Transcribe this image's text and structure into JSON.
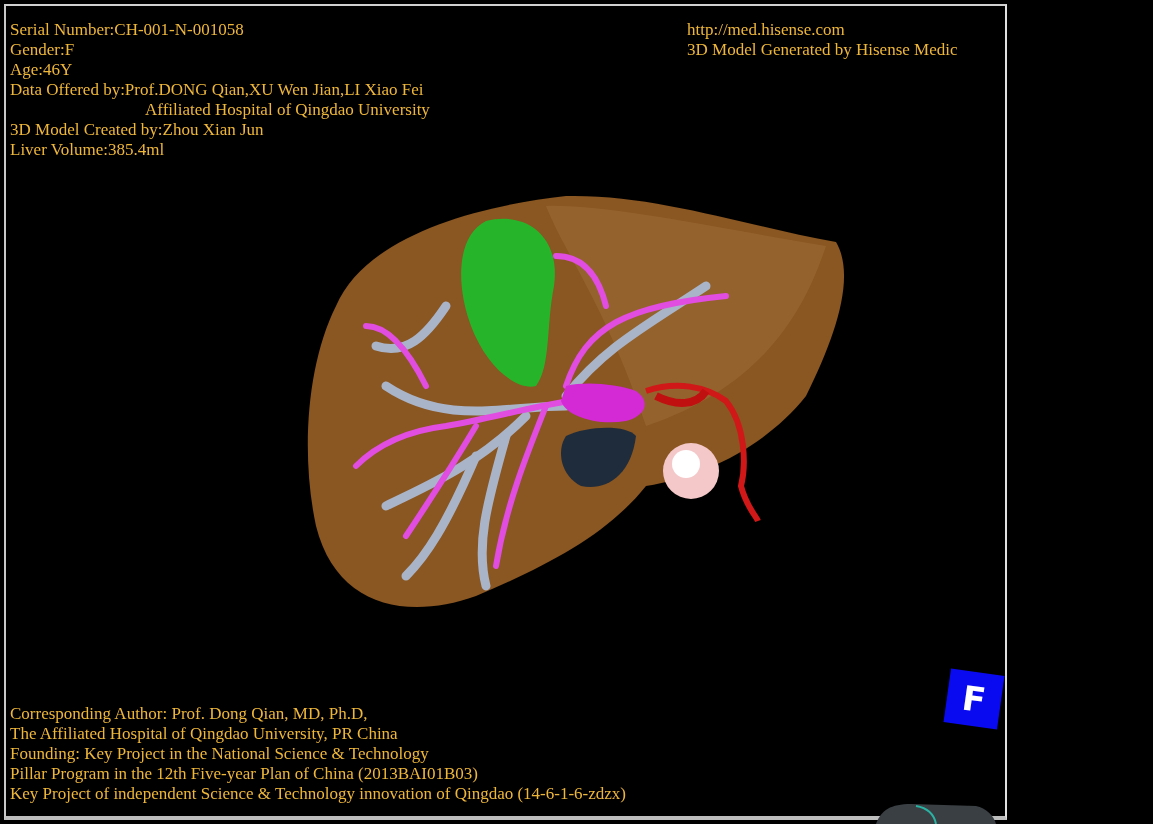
{
  "viewport": {
    "patient_info": [
      {
        "kind": "line",
        "text": "Serial Number:CH-001-N-001058"
      },
      {
        "kind": "line",
        "text": "Gender:F"
      },
      {
        "kind": "line",
        "text": "Age:46Y"
      },
      {
        "kind": "line",
        "text": "Data Offered by:Prof.DONG Qian,XU Wen Jian,LI Xiao Fei"
      },
      {
        "kind": "continuation",
        "text": "Affiliated Hospital of Qingdao University"
      },
      {
        "kind": "line",
        "text": "3D Model Created by:Zhou Xian Jun"
      },
      {
        "kind": "line",
        "text": "Liver Volume:385.4ml"
      }
    ],
    "credits": [
      "http://med.hisense.com",
      "3D Model Generated by Hisense Medic"
    ],
    "orientation_cube": {
      "label": "F"
    },
    "footer": [
      "Corresponding Author: Prof. Dong Qian, MD, Ph.D,",
      "The Affiliated Hospital of Qingdao University, PR China",
      "Founding: Key Project in the National Science & Technology",
      "Pillar Program in the 12th Five-year Plan of China (2013BAI01B03)",
      "Key Project of independent Science & Technology innovation of Qingdao (14-6-1-6-zdzx)"
    ]
  }
}
